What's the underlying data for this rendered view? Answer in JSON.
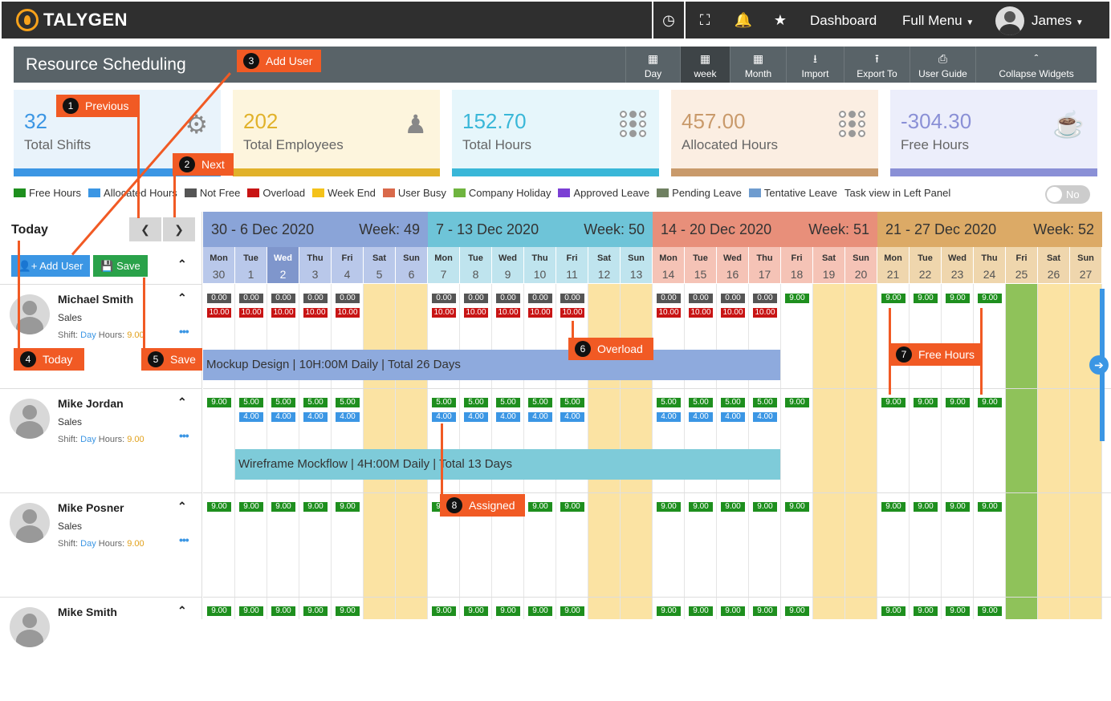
{
  "topbar": {
    "brand": "TALYGEN",
    "dashboard": "Dashboard",
    "full_menu": "Full Menu",
    "user": "James"
  },
  "header": {
    "title": "Resource Scheduling",
    "buttons": [
      {
        "label": "Day",
        "icon": "calendar-icon"
      },
      {
        "label": "week",
        "icon": "calendar-icon",
        "active": true
      },
      {
        "label": "Month",
        "icon": "calendar-icon"
      },
      {
        "label": "Import",
        "icon": "download-icon"
      },
      {
        "label": "Export To",
        "icon": "upload-icon"
      },
      {
        "label": "User Guide",
        "icon": "document-icon"
      },
      {
        "label": "Collapse Widgets",
        "icon": "double-chevron-up-icon"
      }
    ]
  },
  "widgets": [
    {
      "value": "32",
      "label": "Total Shifts",
      "color": "#3b96e4",
      "bg": "#e9f3fb",
      "icon": "gear-icon"
    },
    {
      "value": "202",
      "label": "Total Employees",
      "color": "#e1b22a",
      "bg": "#fdf5dd",
      "icon": "group-icon"
    },
    {
      "value": "152.70",
      "label": "Total Hours",
      "color": "#39b7d8",
      "bg": "#e6f6fb",
      "icon": "dots-icon"
    },
    {
      "value": "457.00",
      "label": "Allocated Hours",
      "color": "#c99a6b",
      "bg": "#fbeee2",
      "icon": "dots-icon"
    },
    {
      "value": "-304.30",
      "label": "Free Hours",
      "color": "#8a90d6",
      "bg": "#eceefb",
      "icon": "coffee-icon"
    }
  ],
  "legend": [
    {
      "label": "Free Hours",
      "color": "#1e8f1e"
    },
    {
      "label": "Allocated Hours",
      "color": "#3b96e4"
    },
    {
      "label": "Not Free",
      "color": "#555"
    },
    {
      "label": "Overload",
      "color": "#c81414"
    },
    {
      "label": "Week End",
      "color": "#f4c21a"
    },
    {
      "label": "User Busy",
      "color": "#d9694a"
    },
    {
      "label": "Company Holiday",
      "color": "#6fb43f"
    },
    {
      "label": "Approved Leave",
      "color": "#7b3fd4"
    },
    {
      "label": "Pending Leave",
      "color": "#6f8061"
    },
    {
      "label": "Tentative Leave",
      "color": "#6f9ccf"
    },
    {
      "label": "Task view in Left Panel",
      "color": ""
    }
  ],
  "toggle": "No",
  "left": {
    "today": "Today",
    "add_user": "Add User",
    "save": "Save"
  },
  "users": [
    {
      "name": "Michael Smith",
      "dept": "Sales",
      "shift_label": "Shift:",
      "shift": "Day",
      "hours_label": "Hours:",
      "hours": "9.00"
    },
    {
      "name": "Mike Jordan",
      "dept": "Sales",
      "shift_label": "Shift:",
      "shift": "Day",
      "hours_label": "Hours:",
      "hours": "9.00"
    },
    {
      "name": "Mike Posner",
      "dept": "Sales",
      "shift_label": "Shift:",
      "shift": "Day",
      "hours_label": "Hours:",
      "hours": "9.00"
    },
    {
      "name": "Mike Smith",
      "dept": "",
      "shift_label": "",
      "shift": "",
      "hours_label": "",
      "hours": ""
    }
  ],
  "weeks": [
    {
      "range": "30 - 6 Dec 2020",
      "week": "Week: 49",
      "color": "#8aa4d8"
    },
    {
      "range": "7 - 13 Dec 2020",
      "week": "Week: 50",
      "color": "#6ec4d8"
    },
    {
      "range": "14 - 20 Dec 2020",
      "week": "Week: 51",
      "color": "#e88f7a"
    },
    {
      "range": "21 - 27 Dec 2020",
      "week": "Week: 52",
      "color": "#dcaa66"
    }
  ],
  "days": [
    {
      "n": "Mon",
      "d": "30"
    },
    {
      "n": "Tue",
      "d": "1"
    },
    {
      "n": "Wed",
      "d": "2",
      "today": true
    },
    {
      "n": "Thu",
      "d": "3"
    },
    {
      "n": "Fri",
      "d": "4"
    },
    {
      "n": "Sat",
      "d": "5"
    },
    {
      "n": "Sun",
      "d": "6"
    },
    {
      "n": "Mon",
      "d": "7"
    },
    {
      "n": "Tue",
      "d": "8"
    },
    {
      "n": "Wed",
      "d": "9"
    },
    {
      "n": "Thu",
      "d": "10"
    },
    {
      "n": "Fri",
      "d": "11"
    },
    {
      "n": "Sat",
      "d": "12"
    },
    {
      "n": "Sun",
      "d": "13"
    },
    {
      "n": "Mon",
      "d": "14"
    },
    {
      "n": "Tue",
      "d": "15"
    },
    {
      "n": "Wed",
      "d": "16"
    },
    {
      "n": "Thu",
      "d": "17"
    },
    {
      "n": "Fri",
      "d": "18"
    },
    {
      "n": "Sat",
      "d": "19"
    },
    {
      "n": "Sun",
      "d": "20"
    },
    {
      "n": "Mon",
      "d": "21"
    },
    {
      "n": "Tue",
      "d": "22"
    },
    {
      "n": "Wed",
      "d": "23"
    },
    {
      "n": "Thu",
      "d": "24"
    },
    {
      "n": "Fri",
      "d": "25"
    },
    {
      "n": "Sat",
      "d": "26"
    },
    {
      "n": "Sun",
      "d": "27"
    }
  ],
  "tasks": [
    {
      "text": "Mockup Design |  10H:00M Daily | Total 26 Days",
      "color": "#8eaadd"
    },
    {
      "text": "Wireframe Mockflow |  4H:00M Daily | Total 13 Days",
      "color": "#7ecbd9"
    }
  ],
  "callouts": [
    {
      "n": "1",
      "label": "Previous"
    },
    {
      "n": "2",
      "label": "Next"
    },
    {
      "n": "3",
      "label": "Add User"
    },
    {
      "n": "4",
      "label": "Today"
    },
    {
      "n": "5",
      "label": "Save"
    },
    {
      "n": "6",
      "label": "Overload"
    },
    {
      "n": "7",
      "label": "Free Hours"
    },
    {
      "n": "8",
      "label": "Assigned"
    }
  ],
  "hours": {
    "r1": {
      "top": [
        "0.00",
        "0.00",
        "0.00",
        "0.00",
        "0.00",
        "",
        "",
        "0.00",
        "0.00",
        "0.00",
        "0.00",
        "0.00",
        "",
        "",
        "0.00",
        "0.00",
        "0.00",
        "0.00",
        "9.00",
        "",
        "",
        "9.00",
        "9.00",
        "9.00",
        "9.00",
        "",
        "",
        ""
      ],
      "bot": [
        "10.00",
        "10.00",
        "10.00",
        "10.00",
        "10.00",
        "",
        "",
        "10.00",
        "10.00",
        "10.00",
        "10.00",
        "10.00",
        "",
        "",
        "10.00",
        "10.00",
        "10.00",
        "10.00",
        "",
        "",
        "",
        "",
        "",
        "",
        "",
        "",
        "",
        ""
      ]
    },
    "r2": {
      "top": [
        "9.00",
        "5.00",
        "5.00",
        "5.00",
        "5.00",
        "",
        "",
        "5.00",
        "5.00",
        "5.00",
        "5.00",
        "5.00",
        "",
        "",
        "5.00",
        "5.00",
        "5.00",
        "5.00",
        "9.00",
        "",
        "",
        "9.00",
        "9.00",
        "9.00",
        "9.00",
        "",
        "",
        ""
      ],
      "bot": [
        "",
        "4.00",
        "4.00",
        "4.00",
        "4.00",
        "",
        "",
        "4.00",
        "4.00",
        "4.00",
        "4.00",
        "4.00",
        "",
        "",
        "4.00",
        "4.00",
        "4.00",
        "4.00",
        "",
        "",
        "",
        "",
        "",
        "",
        "",
        "",
        "",
        ""
      ]
    },
    "r3": {
      "top": [
        "9.00",
        "9.00",
        "9.00",
        "9.00",
        "9.00",
        "",
        "",
        "9.00",
        "9.00",
        "9.00",
        "9.00",
        "9.00",
        "",
        "",
        "9.00",
        "9.00",
        "9.00",
        "9.00",
        "9.00",
        "",
        "",
        "9.00",
        "9.00",
        "9.00",
        "9.00",
        "",
        "",
        ""
      ]
    },
    "r4": {
      "top": [
        "9.00",
        "9.00",
        "9.00",
        "9.00",
        "9.00",
        "",
        "",
        "9.00",
        "9.00",
        "9.00",
        "9.00",
        "9.00",
        "",
        "",
        "9.00",
        "9.00",
        "9.00",
        "9.00",
        "9.00",
        "",
        "",
        "9.00",
        "9.00",
        "9.00",
        "9.00",
        "",
        "",
        ""
      ]
    }
  }
}
